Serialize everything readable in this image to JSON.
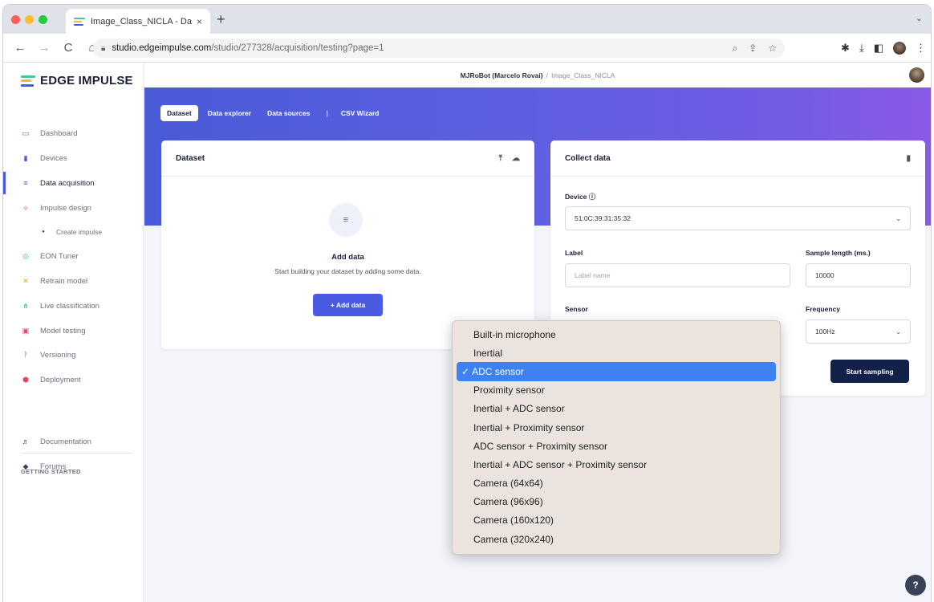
{
  "browser": {
    "tab_title": "Image_Class_NICLA - Da",
    "tab_close": "×",
    "new_tab": "+",
    "tab_menu": "⌄",
    "url_host": "studio.edgeimpulse.com",
    "url_path": "/studio/277328/acquisition/testing?page=1",
    "back": "←",
    "forward": "→",
    "reload": "C",
    "home": "⌂"
  },
  "sidebar": {
    "brand": "EDGE IMPULSE",
    "items": [
      {
        "label": "Dashboard",
        "icon": "▭"
      },
      {
        "label": "Devices",
        "icon": "▮"
      },
      {
        "label": "Data acquisition",
        "icon": "≡"
      },
      {
        "label": "Impulse design",
        "icon": "⟡"
      },
      {
        "label": "Create impulse",
        "icon": "●"
      },
      {
        "label": "EON Tuner",
        "icon": "◎"
      },
      {
        "label": "Retrain model",
        "icon": "✕"
      },
      {
        "label": "Live classification",
        "icon": "⋔"
      },
      {
        "label": "Model testing",
        "icon": "▣"
      },
      {
        "label": "Versioning",
        "icon": "ᚹ"
      },
      {
        "label": "Deployment",
        "icon": "⬢"
      }
    ],
    "section_heading": "GETTING STARTED",
    "getting_started": [
      {
        "label": "Documentation",
        "icon": "♬"
      },
      {
        "label": "Forums",
        "icon": "◆"
      }
    ]
  },
  "topbar": {
    "owner": "MJRoBot (Marcelo Rovai)",
    "separator": "/",
    "project": "Image_Class_NICLA"
  },
  "subtabs": [
    "Dataset",
    "Data explorer",
    "Data sources",
    "CSV Wizard"
  ],
  "subtabs_pipe": "|",
  "dataset_card": {
    "title": "Dataset",
    "empty_title": "Add data",
    "empty_subtitle": "Start building your dataset by adding some data.",
    "add_button": "+ Add data"
  },
  "collect_card": {
    "title": "Collect data",
    "device_label": "Device ⓘ",
    "device_value": "51:0C:39:31:35:32",
    "label_label": "Label",
    "label_placeholder": "Label name",
    "sample_length_label": "Sample length (ms.)",
    "sample_length_value": "10000",
    "sensor_label": "Sensor",
    "frequency_label": "Frequency",
    "frequency_value": "100Hz",
    "start_button": "Start sampling"
  },
  "sensor_menu": {
    "check": "✓",
    "options": [
      "Built-in microphone",
      "Inertial",
      "ADC sensor",
      "Proximity sensor",
      "Inertial + ADC sensor",
      "Inertial + Proximity sensor",
      "ADC sensor + Proximity sensor",
      "Inertial + ADC sensor + Proximity sensor",
      "Camera (64x64)",
      "Camera (96x96)",
      "Camera (160x120)",
      "Camera (320x240)"
    ],
    "selected_index": 2
  },
  "help_label": "?",
  "colors": {
    "accent": "#4a5ae3",
    "hero_start": "#4a5ad8",
    "hero_end": "#8a5ae6",
    "dark_button": "#12204a",
    "menu_selected": "#3d82f0"
  }
}
